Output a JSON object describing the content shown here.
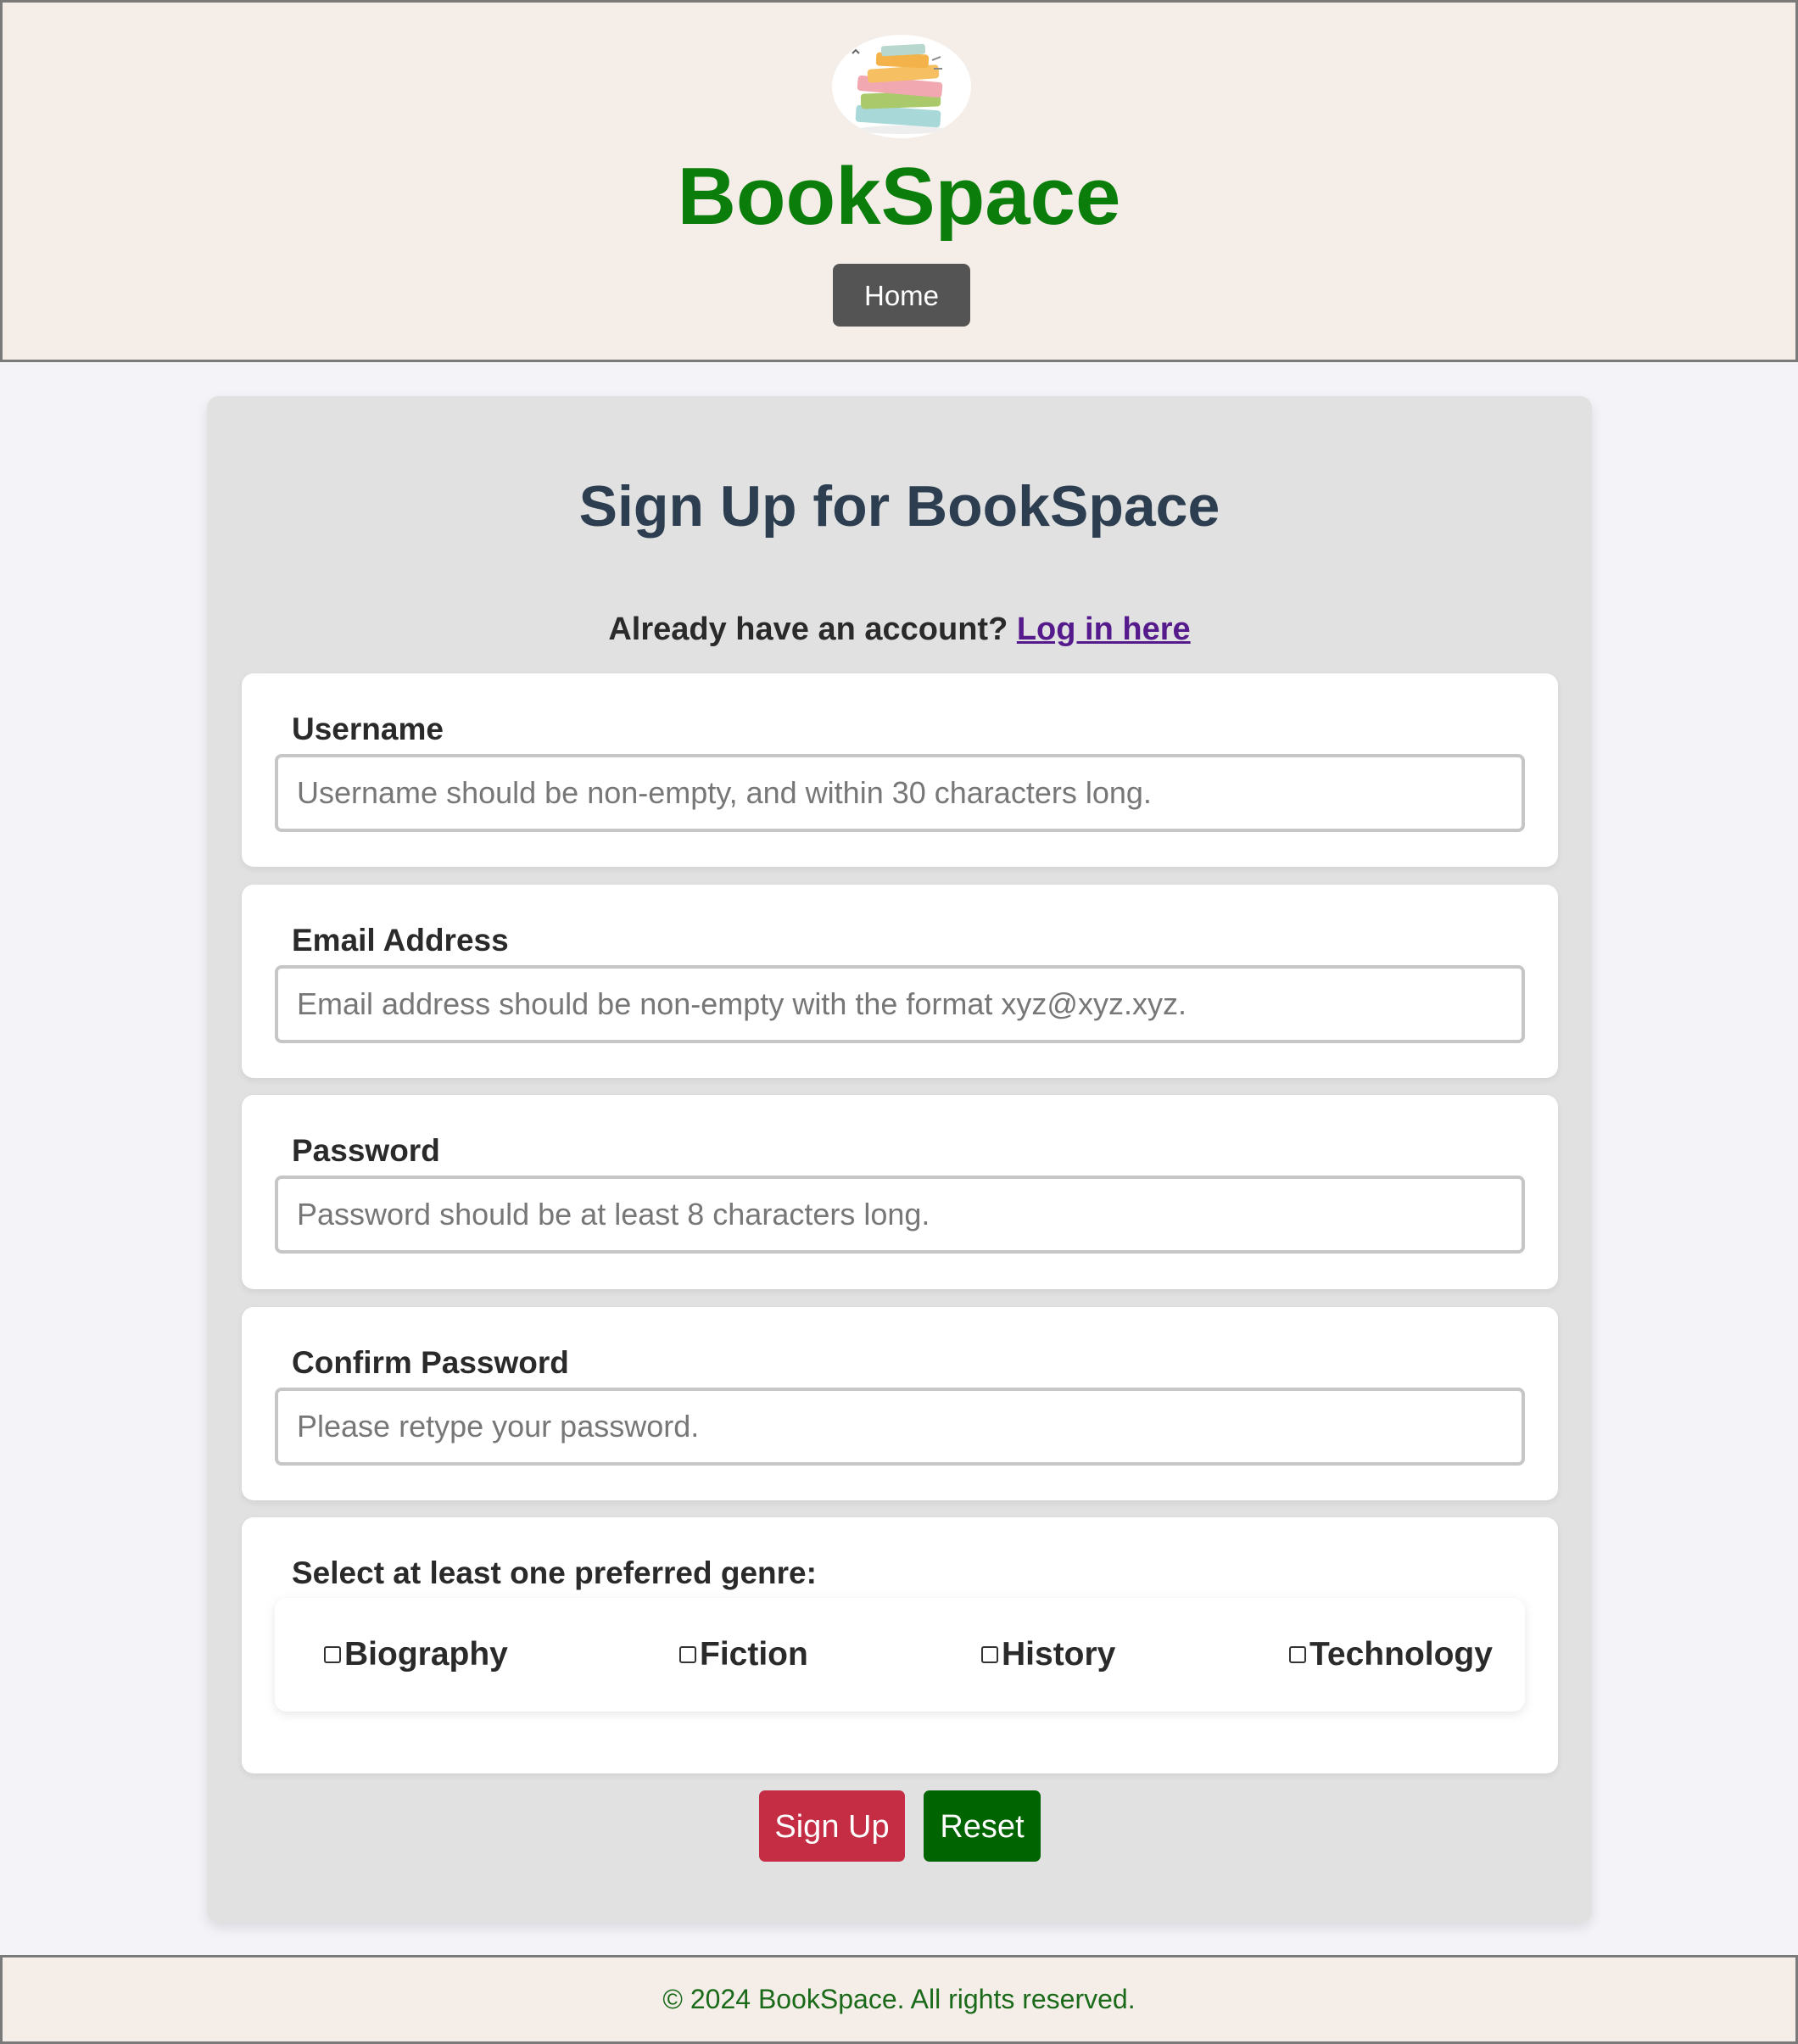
{
  "header": {
    "brand": "BookSpace",
    "nav": {
      "home_label": "Home"
    }
  },
  "form": {
    "title": "Sign Up for BookSpace",
    "login_prompt": "Already have an account?",
    "login_link": "Log in here",
    "fields": [
      {
        "label": "Username",
        "placeholder": "Username should be non-empty, and within 30 characters long.",
        "value": ""
      },
      {
        "label": "Email Address",
        "placeholder": "Email address should be non-empty with the format xyz@xyz.xyz.",
        "value": ""
      },
      {
        "label": "Password",
        "placeholder": "Password should be at least 8 characters long.",
        "value": ""
      },
      {
        "label": "Confirm Password",
        "placeholder": "Please retype your password.",
        "value": ""
      }
    ],
    "genre": {
      "label": "Select at least one preferred genre:",
      "options": [
        {
          "label": "Biography",
          "checked": false
        },
        {
          "label": "Fiction",
          "checked": false
        },
        {
          "label": "History",
          "checked": false
        },
        {
          "label": "Technology",
          "checked": false
        }
      ]
    },
    "buttons": {
      "signup": "Sign Up",
      "reset": "Reset"
    }
  },
  "footer": {
    "text": "© 2024 BookSpace. All rights reserved."
  },
  "colors": {
    "brand": "#0a7d0a",
    "signup_button": "#c42d44",
    "reset_button": "#006400",
    "home_button": "#545454",
    "header_bg": "#f5eee8"
  },
  "icons": {
    "logo": "book-stack-icon"
  }
}
